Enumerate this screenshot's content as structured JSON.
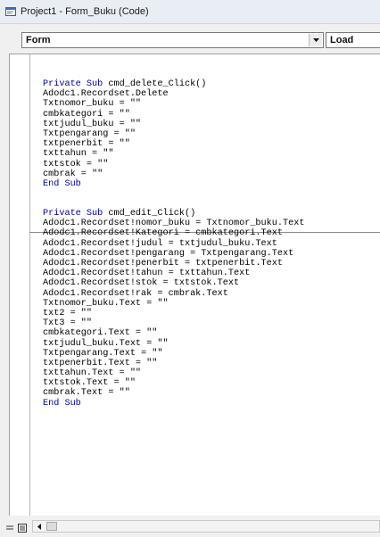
{
  "window": {
    "title": "Project1 - Form_Buku (Code)",
    "icon": "vb-code-window-icon"
  },
  "toolbar": {
    "object_combo": "Form",
    "procedure_combo": "Load"
  },
  "code": {
    "block1": [
      {
        "kw": "Private Sub",
        "rest": " cmd_delete_Click()"
      },
      {
        "text": "Adodc1.Recordset.Delete"
      },
      {
        "text": "Txtnomor_buku = \"\""
      },
      {
        "text": "cmbkategori = \"\""
      },
      {
        "text": "txtjudul_buku = \"\""
      },
      {
        "text": "Txtpengarang = \"\""
      },
      {
        "text": "txtpenerbit = \"\""
      },
      {
        "text": "txttahun = \"\""
      },
      {
        "text": "txtstok = \"\""
      },
      {
        "text": "cmbrak = \"\""
      },
      {
        "kw": "End Sub",
        "rest": ""
      }
    ],
    "block2": [
      {
        "kw": "Private Sub",
        "rest": " cmd_edit_Click()"
      },
      {
        "text": "Adodc1.Recordset!nomor_buku = Txtnomor_buku.Text"
      },
      {
        "text": "Adodc1.Recordset!Kategori = cmbkategori.Text"
      },
      {
        "text": "Adodc1.Recordset!judul = txtjudul_buku.Text"
      },
      {
        "text": "Adodc1.Recordset!pengarang = Txtpengarang.Text"
      },
      {
        "text": "Adodc1.Recordset!penerbit = txtpenerbit.Text"
      },
      {
        "text": "Adodc1.Recordset!tahun = txttahun.Text"
      },
      {
        "text": "Adodc1.Recordset!stok = txtstok.Text"
      },
      {
        "text": "Adodc1.Recordset!rak = cmbrak.Text"
      },
      {
        "text": "Txtnomor_buku.Text = \"\""
      },
      {
        "text": "txt2 = \"\""
      },
      {
        "text": "Txt3 = \"\""
      },
      {
        "text": "cmbkategori.Text = \"\""
      },
      {
        "text": "txtjudul_buku.Text = \"\""
      },
      {
        "text": "Txtpengarang.Text = \"\""
      },
      {
        "text": "txtpenerbit.Text = \"\""
      },
      {
        "text": "txttahun.Text = \"\""
      },
      {
        "text": "txtstok.Text = \"\""
      },
      {
        "text": "cmbrak.Text = \"\""
      },
      {
        "kw": "End Sub",
        "rest": ""
      }
    ]
  },
  "colors": {
    "keyword": "#00009c",
    "code_text": "#000000",
    "editor_bg": "#ffffff",
    "chrome_bg": "#f0f0f0"
  }
}
